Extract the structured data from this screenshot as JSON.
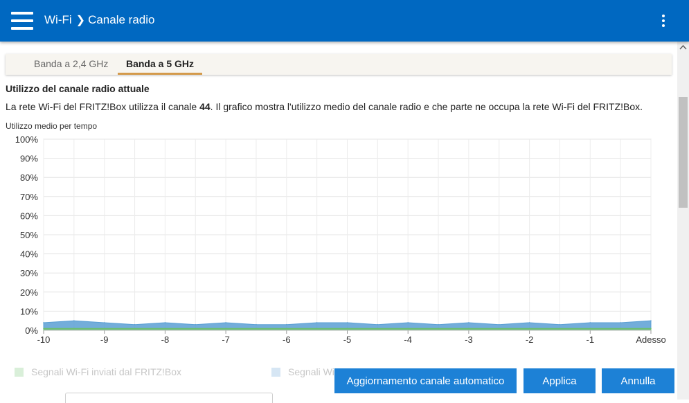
{
  "header": {
    "breadcrumb": [
      "Wi-Fi",
      "Canale radio"
    ]
  },
  "tabs": [
    {
      "label": "Banda a 2,4 GHz",
      "active": false
    },
    {
      "label": "Banda a 5 GHz",
      "active": true
    }
  ],
  "section": {
    "title": "Utilizzo del canale radio attuale",
    "desc_before": "La rete Wi-Fi del FRITZ!Box utilizza il canale ",
    "channel": "44",
    "desc_after": ". Il grafico mostra l'utilizzo medio del canale radio e che parte ne occupa la rete Wi-Fi del FRITZ!Box.",
    "chart_label": "Utilizzo medio per tempo"
  },
  "chart_data": {
    "type": "area",
    "title": "Utilizzo medio per tempo",
    "y_tick_labels": [
      "0%",
      "10%",
      "20%",
      "30%",
      "40%",
      "50%",
      "60%",
      "70%",
      "80%",
      "90%",
      "100%"
    ],
    "x_tick_labels": [
      "-10",
      "-9",
      "-8",
      "-7",
      "-6",
      "-5",
      "-4",
      "-3",
      "-2",
      "-1",
      "Adesso"
    ],
    "x": [
      -10,
      -9.5,
      -9,
      -8.5,
      -8,
      -7.5,
      -7,
      -6.5,
      -6,
      -5.5,
      -5,
      -4.5,
      -4,
      -3.5,
      -3,
      -2.5,
      -2,
      -1.5,
      -1,
      -0.5,
      0
    ],
    "ylim": [
      0,
      100
    ],
    "xlim": [
      -10,
      0
    ],
    "grid": true,
    "series": [
      {
        "values": [
          4,
          5,
          4,
          3,
          4,
          3,
          4,
          3,
          3,
          4,
          4,
          3,
          4,
          3,
          4,
          3,
          4,
          3,
          4,
          4,
          5
        ],
        "color": "#5a9fd4"
      },
      {
        "values": [
          1,
          1,
          1,
          1,
          1,
          1,
          1,
          1,
          1,
          1,
          1,
          1,
          1,
          1,
          1,
          1,
          1,
          1,
          1,
          1,
          1
        ],
        "color": "#6cbf6c"
      }
    ]
  },
  "legend": [
    {
      "label": "Segnali Wi-Fi inviati dal FRITZ!Box",
      "color": "#d9efd9"
    },
    {
      "label": "Segnali Wi-Fi",
      "color": "#d6e6f4"
    }
  ],
  "buttons": {
    "auto_update": "Aggiornamento canale automatico",
    "apply": "Applica",
    "cancel": "Annulla"
  }
}
